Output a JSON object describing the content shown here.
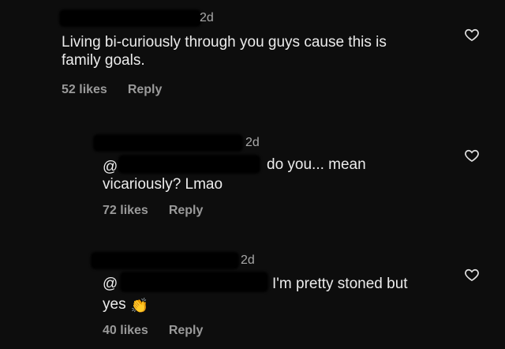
{
  "comments": [
    {
      "timestamp": "2d",
      "text_line1": "Living bi-curiously through you guys cause this is",
      "text_line2": "family goals.",
      "likes": "52 likes",
      "reply": "Reply"
    },
    {
      "timestamp": "2d",
      "mention": "@",
      "text_line1": "do you... mean",
      "text_line2": "vicariously? Lmao",
      "likes": "72 likes",
      "reply": "Reply"
    },
    {
      "timestamp": "2d",
      "mention": "@",
      "text_line1": "I'm pretty stoned but",
      "text_line2": "yes",
      "emoji": "clapping-hands",
      "likes": "40 likes",
      "reply": "Reply"
    }
  ],
  "colors": {
    "background": "#0d0d0d",
    "text": "#ececec",
    "meta": "#9a9a9a",
    "redaction": "#000000",
    "emoji": "#f0b63c"
  },
  "icons": {
    "like": "heart-outline-icon",
    "emoji": "clapping-hands-icon"
  }
}
